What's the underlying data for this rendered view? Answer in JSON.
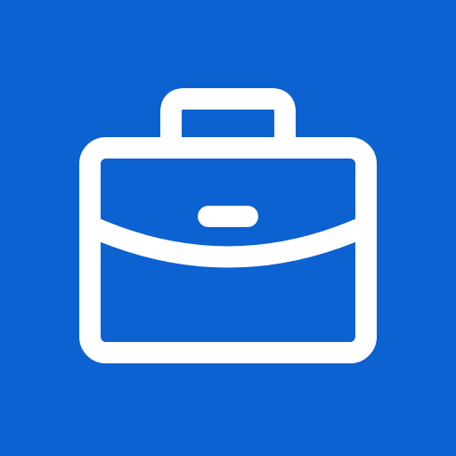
{
  "app_icon": {
    "icon": "briefcase-icon",
    "background_color": "#0B62D0",
    "foreground_color": "#FFFFFF"
  }
}
